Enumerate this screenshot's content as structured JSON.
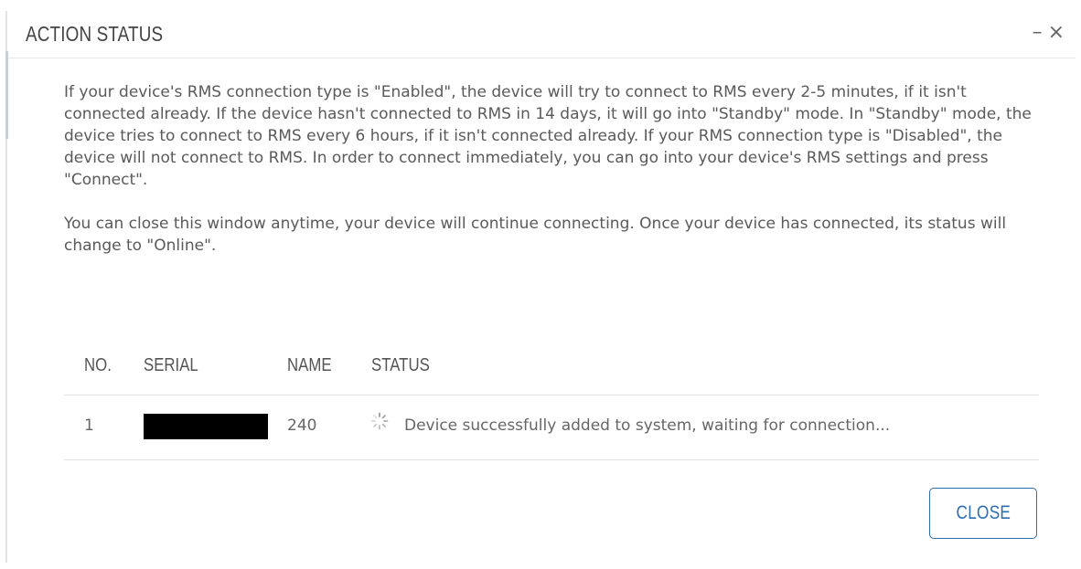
{
  "dialog": {
    "title": "ACTION STATUS",
    "minimize_glyph": "–",
    "close_glyph": "×",
    "paragraphs": [
      "If your device's RMS connection type is \"Enabled\", the device will try to connect to RMS every 2-5 minutes, if it isn't connected already. If the device hasn't connected to RMS in 14 days, it will go into \"Standby\" mode. In \"Standby\" mode, the device tries to connect to RMS every 6 hours, if it isn't connected already. If your RMS connection type is \"Disabled\", the device will not connect to RMS. In order to connect immediately, you can go into your device's RMS settings and press \"Connect\".",
      "You can close this window anytime, your device will continue connecting. Once your device has connected, its status will change to \"Online\"."
    ],
    "close_label": "CLOSE"
  },
  "table": {
    "headers": {
      "no": "NO.",
      "serial": "SERIAL",
      "name": "NAME",
      "status": "STATUS"
    },
    "rows": [
      {
        "no": "1",
        "serial": "",
        "name": "240",
        "status": "Device successfully added to system, waiting for connection...",
        "status_icon": "loading-spinner-icon"
      }
    ]
  },
  "colors": {
    "accent": "#2c6fb0",
    "text": "#5a5a5a",
    "redaction": "#000000"
  }
}
